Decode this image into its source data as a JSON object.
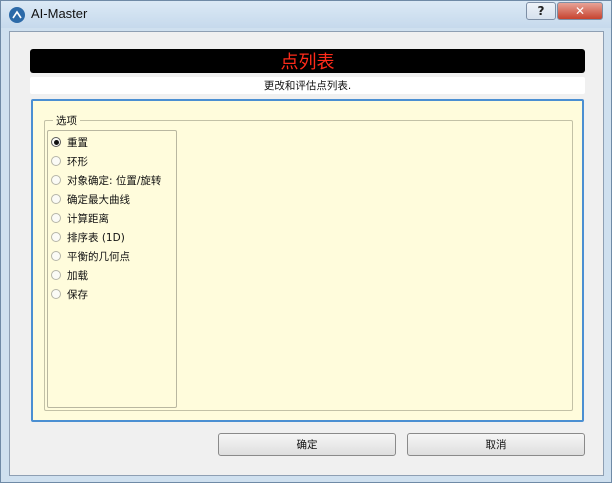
{
  "window": {
    "title": "AI-Master",
    "help_label": "?",
    "close_label": "✕"
  },
  "header": {
    "title": "点列表",
    "title_color": "#ff2b1a",
    "subtitle": "更改和评估点列表."
  },
  "options": {
    "legend": "选项",
    "items": [
      {
        "label": "重置",
        "checked": true
      },
      {
        "label": "环形",
        "checked": false
      },
      {
        "label": "对象确定: 位置/旋转",
        "checked": false
      },
      {
        "label": "确定最大曲线",
        "checked": false
      },
      {
        "label": "计算距离",
        "checked": false
      },
      {
        "label": "排序表 (1D)",
        "checked": false
      },
      {
        "label": "平衡的几何点",
        "checked": false
      },
      {
        "label": "加载",
        "checked": false
      },
      {
        "label": "保存",
        "checked": false
      }
    ]
  },
  "buttons": {
    "ok": "确定",
    "cancel": "取消"
  },
  "colors": {
    "panel_border": "#4b8fd2",
    "panel_bg": "#fffcdc"
  }
}
